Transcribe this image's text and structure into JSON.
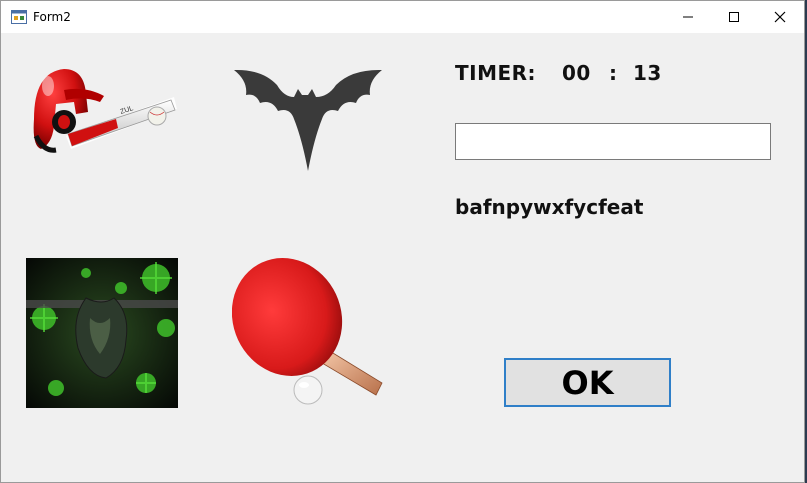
{
  "window": {
    "title": "Form2",
    "controls": {
      "minimize": "minimize-icon",
      "maximize": "maximize-icon",
      "close": "close-icon"
    }
  },
  "images": [
    {
      "name": "baseball-helmet-bat-image",
      "description_icon": "baseball-icon"
    },
    {
      "name": "bat-animal-image",
      "description_icon": "bat-icon"
    },
    {
      "name": "virus-bat-image",
      "description_icon": "virus-icon"
    },
    {
      "name": "ping-pong-paddle-image",
      "description_icon": "paddle-icon"
    }
  ],
  "timer": {
    "label": "TIMER:",
    "minutes": "00",
    "separator": ":",
    "seconds": "13"
  },
  "answer_input": {
    "value": "",
    "placeholder": ""
  },
  "scrambled_word": "bafnpywxfycfeat",
  "ok_button": {
    "label": "OK"
  },
  "colors": {
    "window_bg": "#f0f0f0",
    "ok_border": "#2f7fc8",
    "ok_bg": "#e1e1e1"
  }
}
